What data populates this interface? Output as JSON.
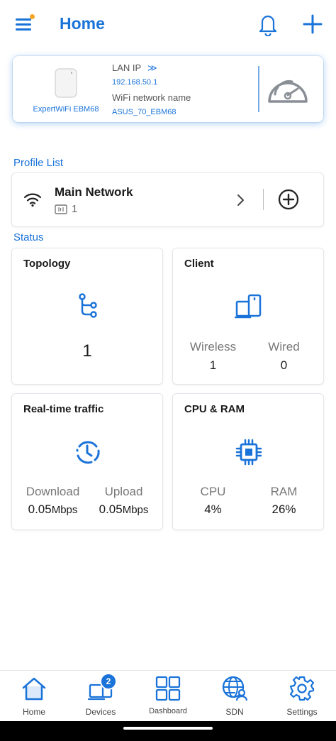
{
  "header": {
    "title": "Home",
    "icons": {
      "menu": "menu-icon",
      "bell": "bell-icon",
      "add": "plus-icon"
    }
  },
  "router": {
    "name": "ExpertWiFi EBM68",
    "lan_ip_label": "LAN IP",
    "lan_ip_arrow": "≫",
    "lan_ip": "192.168.50.1",
    "wifi_label": "WiFi network name",
    "wifi_name": "ASUS_70_EBM68",
    "speedtest_icon": "speedometer-icon"
  },
  "profile_list": {
    "label": "Profile List",
    "profile": {
      "name": "Main Network",
      "device_count": "1"
    }
  },
  "status": {
    "label": "Status",
    "topology": {
      "title": "Topology",
      "value": "1"
    },
    "client": {
      "title": "Client",
      "wireless_label": "Wireless",
      "wireless_value": "1",
      "wired_label": "Wired",
      "wired_value": "0"
    },
    "traffic": {
      "title": "Real-time traffic",
      "download_label": "Download",
      "download_value": "0.05",
      "download_unit": "Mbps",
      "upload_label": "Upload",
      "upload_value": "0.05",
      "upload_unit": "Mbps"
    },
    "cpu_ram": {
      "title": "CPU & RAM",
      "cpu_label": "CPU",
      "cpu_value": "4%",
      "ram_label": "RAM",
      "ram_value": "26%"
    }
  },
  "nav": {
    "items": [
      {
        "label": "Home",
        "icon": "home-icon"
      },
      {
        "label": "Devices",
        "icon": "devices-icon",
        "badge": "2"
      },
      {
        "label": "Dashboard",
        "icon": "dashboard-icon"
      },
      {
        "label": "SDN",
        "icon": "sdn-icon"
      },
      {
        "label": "Settings",
        "icon": "settings-icon"
      }
    ]
  },
  "colors": {
    "accent": "#1a73d9",
    "notification_dot": "#f5a623"
  }
}
